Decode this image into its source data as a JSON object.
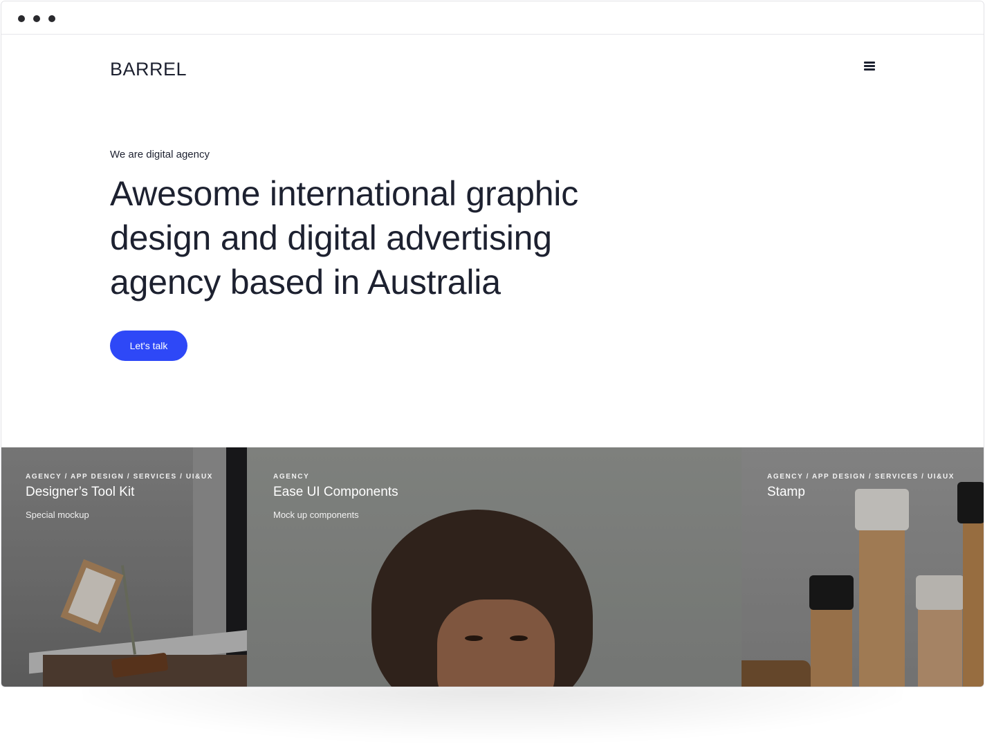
{
  "window": {
    "dots": 3
  },
  "header": {
    "logo": "BARREL",
    "menu_icon": "hamburger-menu-icon"
  },
  "hero": {
    "eyebrow": "We are digital agency",
    "headline_lines": [
      "Awesome international graphic",
      "design and digital advertising",
      "agency based in Australia"
    ],
    "cta_label": "Let's talk"
  },
  "colors": {
    "accent": "#2e48f7",
    "text": "#1d2130"
  },
  "gallery": [
    {
      "tags": "AGENCY / APP DESIGN / SERVICES / UI&UX",
      "title": "Designer’s Tool Kit",
      "subtitle": "Special mockup"
    },
    {
      "tags": "AGENCY",
      "title": "Ease UI Components",
      "subtitle": "Mock up components"
    },
    {
      "tags": "AGENCY / APP DESIGN / SERVICES / UI&UX",
      "title": "Stamp",
      "subtitle": ""
    }
  ]
}
